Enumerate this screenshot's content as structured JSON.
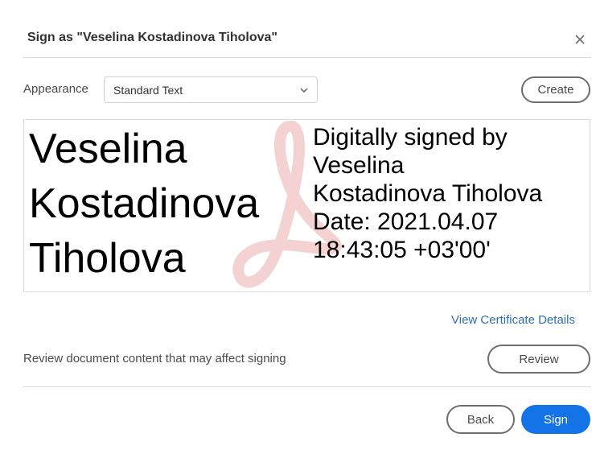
{
  "dialog": {
    "title": "Sign as \"Veselina Kostadinova Tiholova\"",
    "close_icon": "close-icon"
  },
  "appearance": {
    "label": "Appearance",
    "selected": "Standard Text",
    "create_label": "Create"
  },
  "preview": {
    "name_lines": [
      "Veselina",
      "Kostadinova",
      "Tiholova"
    ],
    "detail_lines": [
      "Digitally signed by",
      "Veselina",
      "Kostadinova Tiholova",
      "Date: 2021.04.07",
      "18:43:05 +03'00'"
    ],
    "watermark_icon": "acrobat-logo-watermark"
  },
  "certificate": {
    "link_label": "View Certificate Details"
  },
  "review": {
    "text": "Review document content that may affect signing",
    "button_label": "Review"
  },
  "footer": {
    "back_label": "Back",
    "sign_label": "Sign"
  },
  "colors": {
    "accent": "#1473e6",
    "link": "#2f6fb6",
    "watermark": "#f2c4c4"
  }
}
